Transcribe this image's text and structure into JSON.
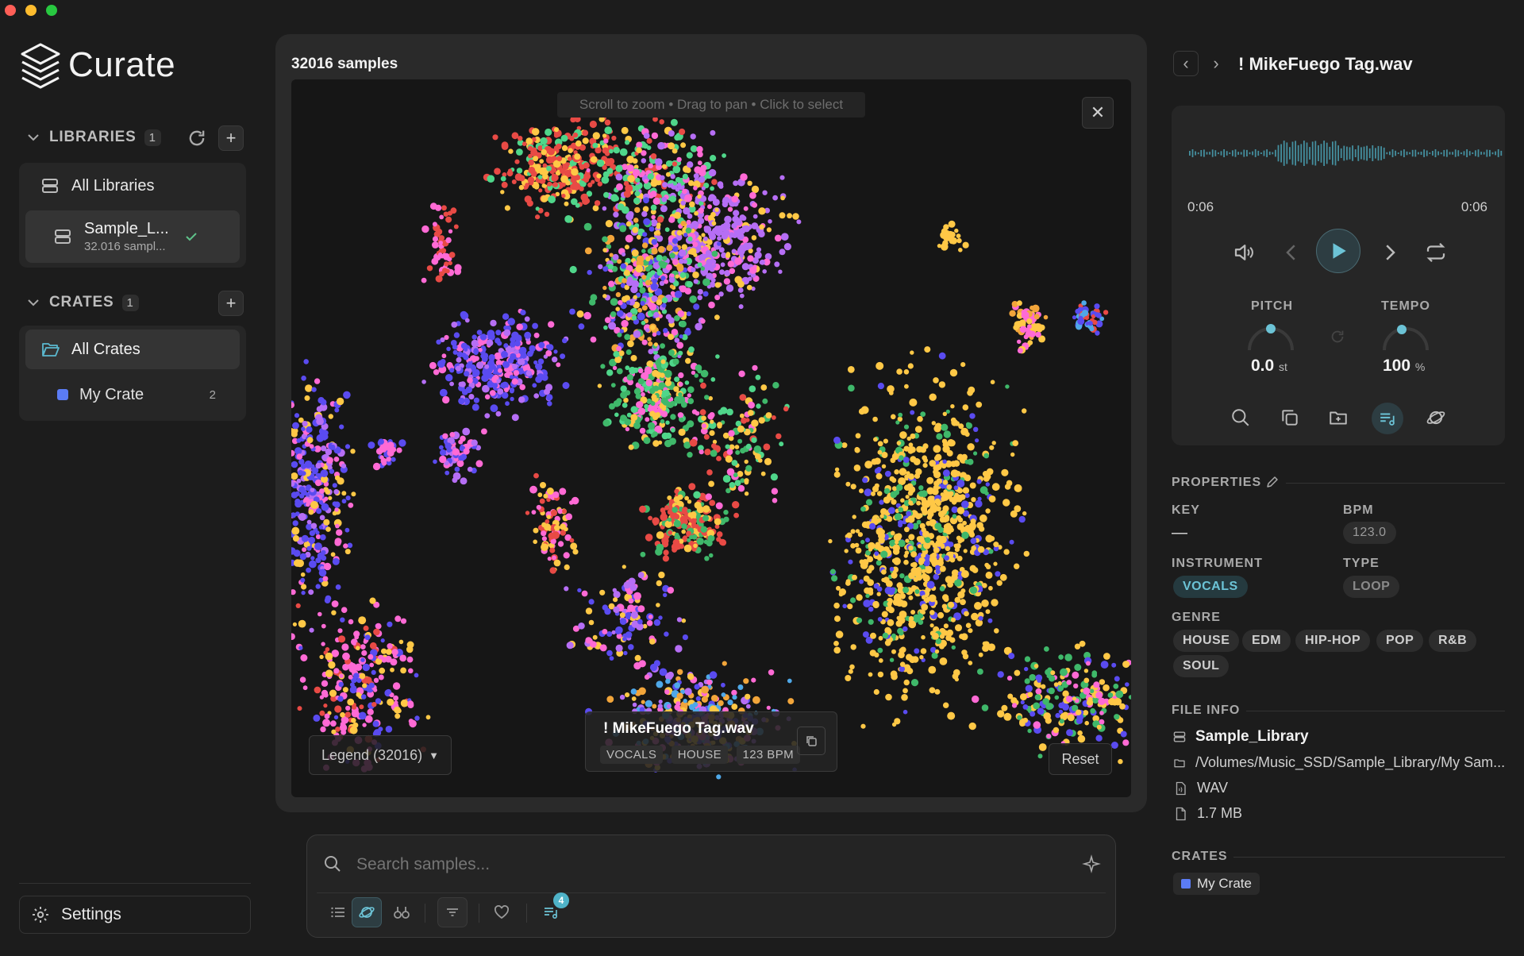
{
  "window": {
    "controls": {
      "close_color": "#ff5f57",
      "minimize_color": "#febc2e",
      "zoom_color": "#28c840"
    }
  },
  "app": {
    "name": "Curate"
  },
  "sidebar": {
    "libraries": {
      "label": "LIBRARIES",
      "count": "1",
      "items": [
        {
          "label": "All Libraries"
        },
        {
          "label": "Sample_L...",
          "subtitle": "32.016 sampl..."
        }
      ]
    },
    "crates": {
      "label": "CRATES",
      "count": "1",
      "items": [
        {
          "label": "All Crates"
        },
        {
          "label": "My Crate",
          "count": "2",
          "color": "#5b7cf5"
        }
      ]
    },
    "settings_label": "Settings"
  },
  "map": {
    "sample_count": "32016 samples",
    "hint": "Scroll to zoom • Drag to pan • Click to select",
    "legend_label": "Legend (32016)",
    "reset_label": "Reset",
    "tooltip": {
      "title": "! MikeFuego Tag.wav",
      "tags": [
        "VOCALS",
        "HOUSE",
        "123 BPM"
      ]
    },
    "colors": [
      "#e84a45",
      "#4fd68a",
      "#b66ef5",
      "#5a4bf0",
      "#ff6ad5",
      "#ffc846",
      "#3fb86a",
      "#f2a53a",
      "#4fa8e8"
    ]
  },
  "search": {
    "placeholder": "Search samples...",
    "queue_badge": "4"
  },
  "detail": {
    "title": "! MikeFuego Tag.wav",
    "time_current": "0:06",
    "time_total": "0:06",
    "pitch_label": "PITCH",
    "pitch_value": "0.0",
    "pitch_unit": "st",
    "tempo_label": "TEMPO",
    "tempo_value": "100",
    "tempo_unit": "%",
    "accent": "#4fb3c8",
    "properties_label": "PROPERTIES",
    "key_label": "KEY",
    "key_value": "—",
    "bpm_label": "BPM",
    "bpm_value": "123.0",
    "instrument_label": "INSTRUMENT",
    "instrument_value": "VOCALS",
    "type_label": "TYPE",
    "type_value": "LOOP",
    "genre_label": "GENRE",
    "genres": [
      "HOUSE",
      "EDM",
      "HIP-HOP",
      "POP",
      "R&B",
      "SOUL"
    ],
    "file_info_label": "FILE INFO",
    "file_library": "Sample_Library",
    "file_path": "/Volumes/Music_SSD/Sample_Library/My Sam...",
    "file_format": "WAV",
    "file_size": "1.7 MB",
    "crates_label": "CRATES",
    "crate_chip": "My Crate"
  }
}
